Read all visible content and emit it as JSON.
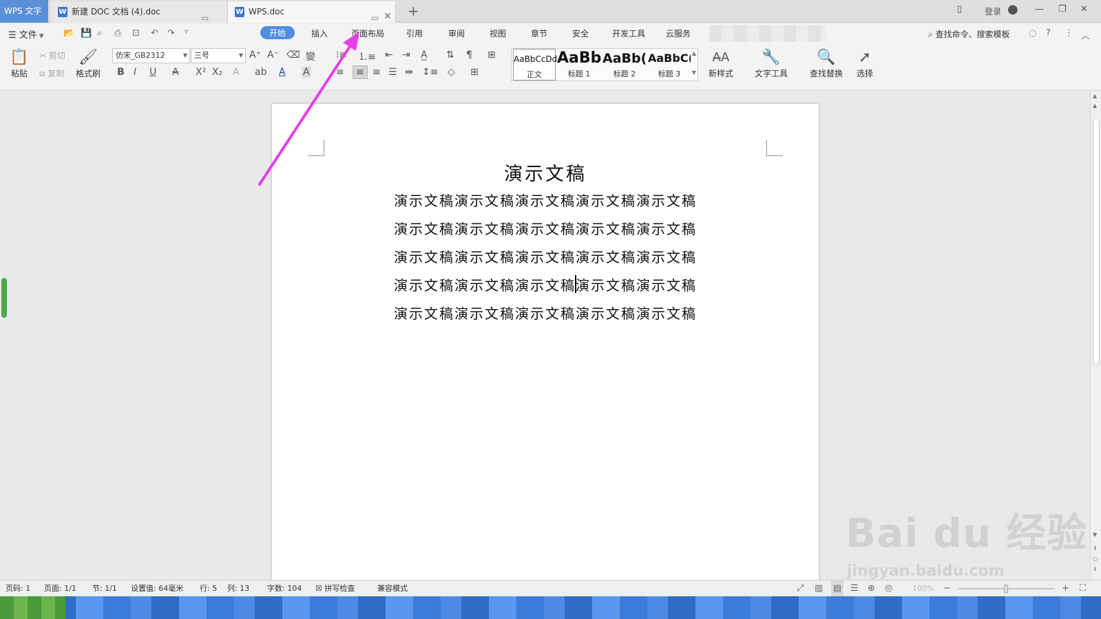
{
  "tabbar": {
    "app_name": "WPS 文字",
    "tabs": [
      {
        "label": "新建 DOC 文档 (4).doc"
      },
      {
        "label": "WPS.doc"
      }
    ],
    "login": "登录"
  },
  "menubar": {
    "file": "文件",
    "ribbon_tabs": [
      "开始",
      "插入",
      "页面布局",
      "引用",
      "审阅",
      "视图",
      "章节",
      "安全",
      "开发工具",
      "云服务"
    ],
    "search_cmd": "查找命令、搜索模板"
  },
  "toolbar": {
    "paste": "粘贴",
    "cut": "剪切",
    "copy": "复制",
    "format_painter": "格式刷",
    "font_name": "仿宋_GB2312",
    "font_size": "三号",
    "styles": [
      {
        "preview": "AaBbCcDd",
        "label": "正文"
      },
      {
        "preview": "AaBb",
        "label": "标题 1"
      },
      {
        "preview": "AaBb(",
        "label": "标题 2"
      },
      {
        "preview": "AaBbC(",
        "label": "标题 3"
      }
    ],
    "new_style": "新样式",
    "text_tools": "文字工具",
    "find_replace": "查找替换",
    "select": "选择"
  },
  "document": {
    "title": "演示文稿",
    "lines": [
      "演示文稿演示文稿演示文稿演示文稿演示文稿",
      "演示文稿演示文稿演示文稿演示文稿演示文稿",
      "演示文稿演示文稿演示文稿演示文稿演示文稿",
      "演示文稿演示文稿演示文稿演示文稿演示文稿",
      "演示文稿演示文稿演示文稿演示文稿演示文稿"
    ]
  },
  "statusbar": {
    "page_code": "页码: 1",
    "pages": "页面: 1/1",
    "section": "节: 1/1",
    "setting": "设置值: 64毫米",
    "row": "行: 5",
    "col": "列: 13",
    "word_count": "字数: 104",
    "spell_check": "拼写检查",
    "compat_mode": "兼容模式",
    "zoom": "100%"
  },
  "watermark": {
    "brand": "Bai du 经验",
    "url": "jingyan.baidu.com"
  },
  "colors": {
    "accent": "#4f8ee0",
    "annotation_arrow": "#e83ee8"
  }
}
